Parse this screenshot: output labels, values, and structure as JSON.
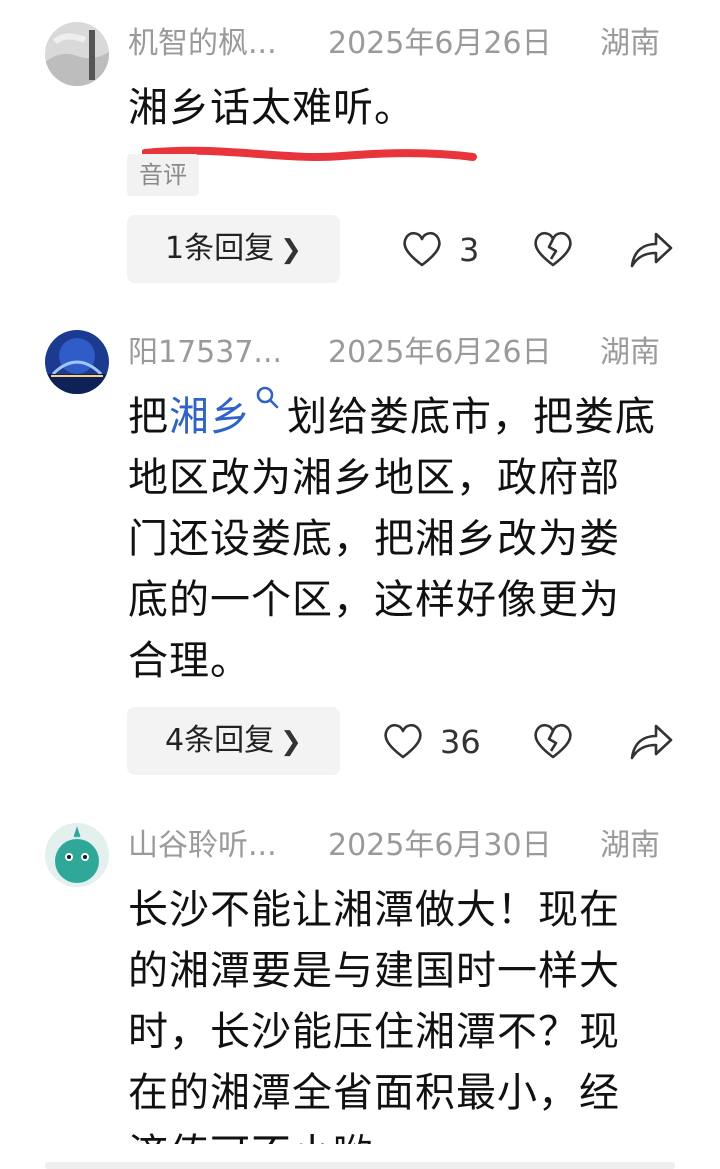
{
  "comments": [
    {
      "username": "机智的枫...",
      "date": "2025年6月26日",
      "region": "湖南",
      "text": "湘乡话太难听。",
      "tag": "音评",
      "reply_label": "1条回复",
      "like_count": "3"
    },
    {
      "username": "阳17537...",
      "date": "2025年6月26日",
      "region": "湖南",
      "text_before": "把",
      "link_text": "湘乡",
      "text_after": "划给娄底市，把娄底地区改为湘乡地区，政府部门还设娄底，把湘乡改为娄底的一个区，这样好像更为合理。",
      "reply_label": "4条回复",
      "like_count": "36"
    },
    {
      "username": "山谷聆听...",
      "date": "2025年6月30日",
      "region": "湖南",
      "text": "长沙不能让湘潭做大！现在的湘潭要是与建国时一样大时，长沙能压住湘潭不？现在的湘潭全省面积最小，经济值可不小哟"
    }
  ],
  "icons": {
    "like": "heart-outline-icon",
    "dislike": "broken-heart-icon",
    "share": "share-arrow-icon",
    "search": "search-icon",
    "chevron": "chevron-right-icon"
  },
  "colors": {
    "underline": "#e8343b",
    "link": "#2f63c7",
    "meta": "#9a9a9a"
  }
}
